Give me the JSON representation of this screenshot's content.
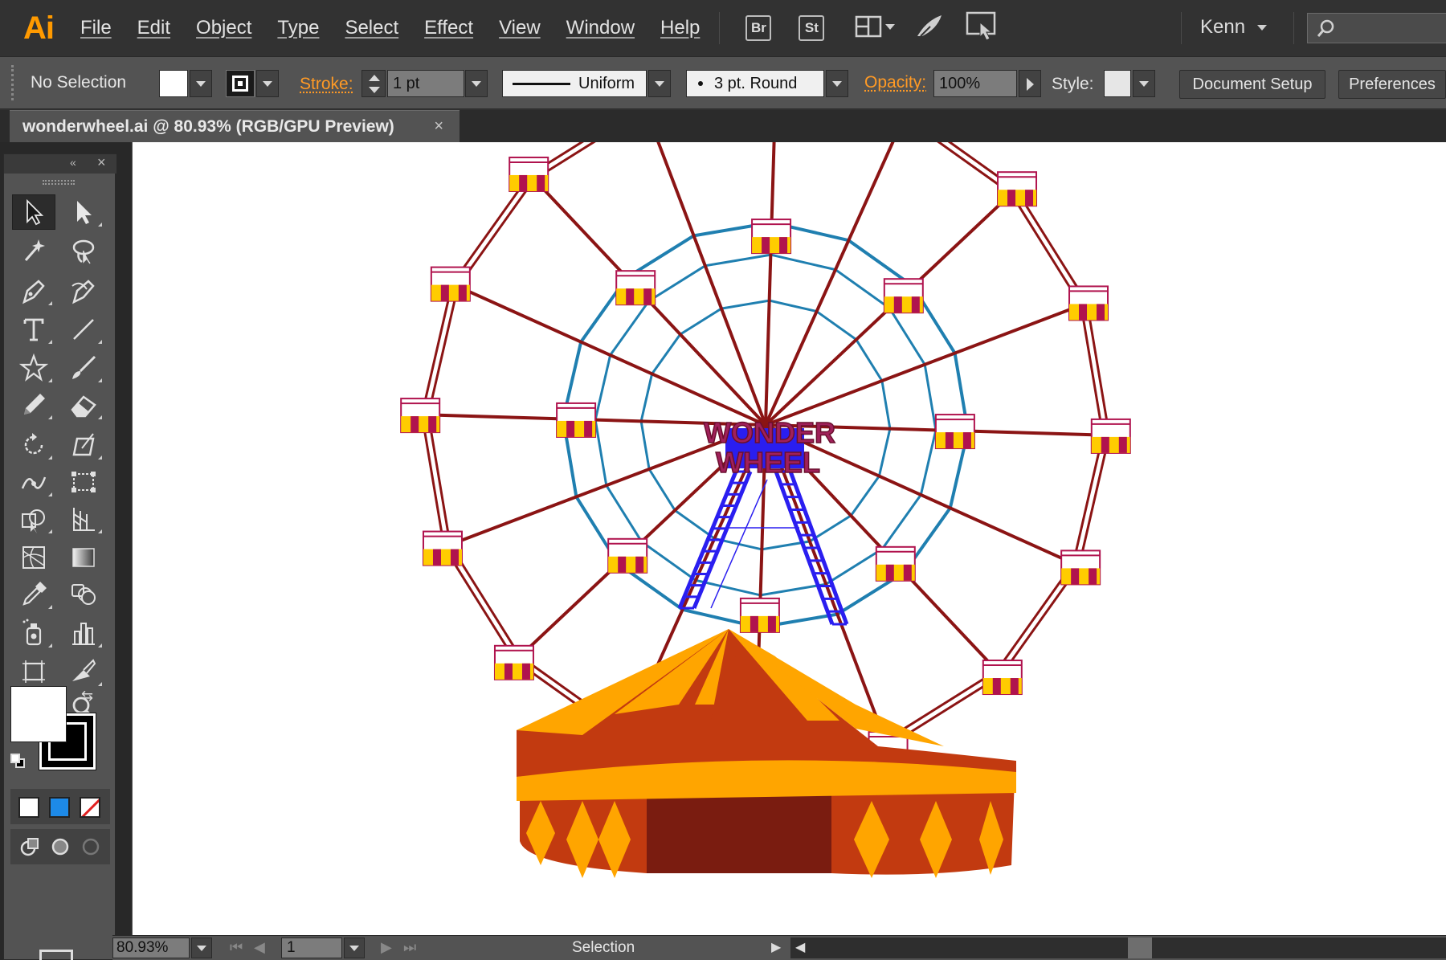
{
  "app": {
    "logo": "Ai",
    "accent": "#ff9a00"
  },
  "menu": {
    "items": [
      "File",
      "Edit",
      "Object",
      "Type",
      "Select",
      "Effect",
      "View",
      "Window",
      "Help"
    ]
  },
  "menubar_icons": {
    "bridge": "Br",
    "stock": "St",
    "arrange": "arrange-documents-icon",
    "gpu": "gpu-performance-icon",
    "touch": "touch-workspace-icon"
  },
  "user": {
    "name": "Kenn"
  },
  "search": {
    "placeholder": "",
    "icon": "search-icon"
  },
  "control_bar": {
    "selection_label": "No Selection",
    "stroke_label": "Stroke:",
    "stroke_weight": "1 pt",
    "profile_label": "Uniform",
    "brush_label": "3 pt. Round",
    "opacity_label": "Opacity:",
    "opacity_value": "100%",
    "style_label": "Style:",
    "document_setup": "Document Setup",
    "preferences": "Preferences",
    "fill_color": "#ffffff",
    "stroke_color": "#000000"
  },
  "document": {
    "tab_title": "wonderwheel.ai @ 80.93% (RGB/GPU Preview)",
    "close_glyph": "×"
  },
  "artwork": {
    "sign_line1": "WONDER",
    "sign_line2": "WHEEL",
    "colors": {
      "frame": "#8b1414",
      "inner_ring": "#1f7fb0",
      "tower": "#2a1ef0",
      "sign": "#8b1a4a",
      "tent_orange": "#ffa500",
      "tent_red": "#c23a10",
      "tent_door": "#7a1c10",
      "gondola_yellow": "#ffcc00",
      "gondola_red": "#b0134e"
    }
  },
  "tools": [
    "selection-tool",
    "direct-selection-tool",
    "magic-wand-tool",
    "lasso-tool",
    "pen-tool",
    "curvature-tool",
    "type-tool",
    "line-segment-tool",
    "star-tool",
    "paintbrush-tool",
    "pencil-tool",
    "eraser-tool",
    "rotate-tool",
    "free-transform-tool",
    "puppet-warp-tool",
    "free-transform-alt-tool",
    "shape-builder-tool",
    "perspective-grid-tool",
    "mesh-tool",
    "gradient-tool",
    "eyedropper-tool",
    "blend-tool",
    "symbol-sprayer-tool",
    "column-graph-tool",
    "artboard-tool",
    "slice-tool",
    "hand-tool",
    "zoom-tool"
  ],
  "status": {
    "zoom": "80.93%",
    "page": "1",
    "mode": "Selection"
  }
}
